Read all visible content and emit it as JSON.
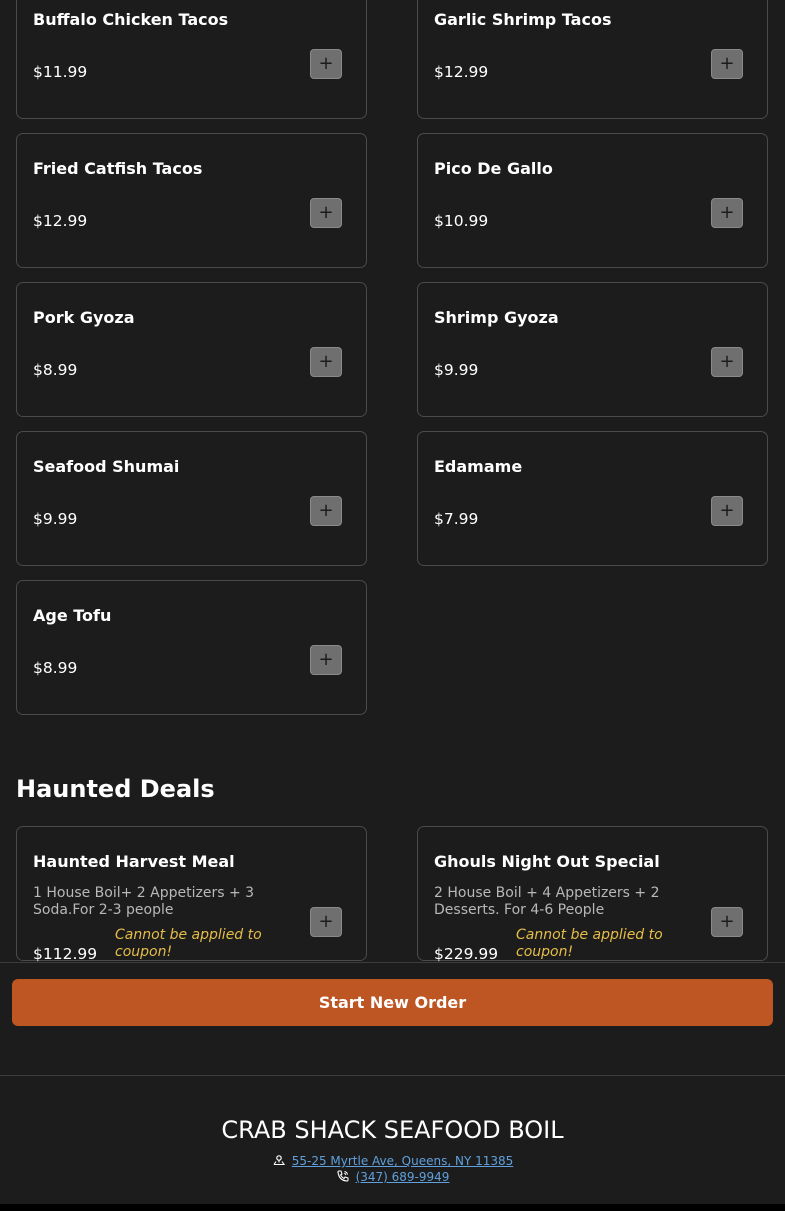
{
  "menu_items": [
    {
      "name": "Buffalo Chicken Tacos",
      "price": "$11.99"
    },
    {
      "name": "Garlic Shrimp Tacos",
      "price": "$12.99"
    },
    {
      "name": "Fried Catfish Tacos",
      "price": "$12.99"
    },
    {
      "name": "Pico De Gallo",
      "price": "$10.99"
    },
    {
      "name": "Pork Gyoza",
      "price": "$8.99"
    },
    {
      "name": "Shrimp Gyoza",
      "price": "$9.99"
    },
    {
      "name": "Seafood Shumai",
      "price": "$9.99"
    },
    {
      "name": "Edamame",
      "price": "$7.99"
    },
    {
      "name": "Age Tofu",
      "price": "$8.99"
    }
  ],
  "add_button_label": "+",
  "deals_section": {
    "title": "Haunted Deals",
    "items": [
      {
        "name": "Haunted Harvest Meal",
        "description": "1 House Boil+ 2 Appetizers + 3 Soda.For 2-3 people",
        "price": "$112.99",
        "note": "Cannot be applied to coupon!"
      },
      {
        "name": "Ghouls Night Out Special",
        "description": "2 House Boil + 4 Appetizers + 2 Desserts. For 4-6 People",
        "price": "$229.99",
        "note": "Cannot be applied to coupon!"
      }
    ]
  },
  "order_bar": {
    "button_label": "Start New Order"
  },
  "footer": {
    "brand": "CRAB SHACK SEAFOOD BOIL",
    "address": "55-25 Myrtle Ave, Queens, NY 11385",
    "phone": "(347) 689-9949",
    "address_icon": "location-icon",
    "phone_icon": "phone-icon"
  },
  "colors": {
    "background": "#1c1c1c",
    "card_border": "#4a4a4a",
    "accent": "#bd5622",
    "note": "#e6bd48",
    "link": "#5fa0dd"
  }
}
